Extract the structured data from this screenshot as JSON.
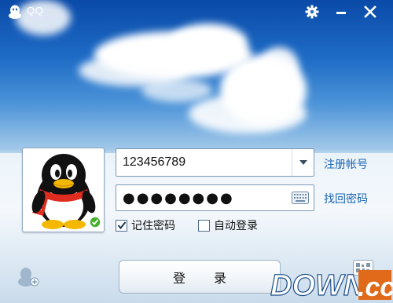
{
  "app": {
    "title": "QQ"
  },
  "titlebar": {
    "settings_icon": "gear-icon",
    "minimize_icon": "minimize-icon",
    "close_icon": "close-icon"
  },
  "login": {
    "account_value": "123456789",
    "password_value": "●●●●●●●●",
    "register_link": "注册帐号",
    "recover_link": "找回密码",
    "remember_label": "记住密码",
    "remember_checked": true,
    "auto_login_label": "自动登录",
    "auto_login_checked": false,
    "login_button": "登录"
  },
  "watermark": {
    "text": "DOWN.cc"
  },
  "colors": {
    "sky_top": "#0a4aa8",
    "link": "#1a63b5",
    "watermark_bg": "#e06a1a",
    "online_badge": "#43b02a"
  }
}
